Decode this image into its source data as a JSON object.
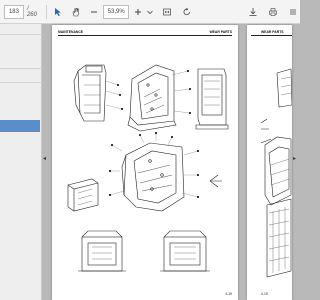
{
  "toolbar": {
    "current_page": "183",
    "total_pages": "/ 260",
    "zoom": "53,9%",
    "icons": [
      "cursor-icon",
      "hand-icon",
      "zoom-out-icon",
      "zoom-in-icon",
      "zoom-dropdown-icon",
      "fit-page-icon",
      "rotate-icon",
      "download-icon",
      "print-icon",
      "more-icon"
    ]
  },
  "sidebar": {
    "selected_color": "#5a8ec9"
  },
  "page_left": {
    "title": "MAINTENANCE",
    "section": "WEAR PARTS",
    "page_number": "4-19"
  },
  "page_right": {
    "section": "WEAR PARTS",
    "page_number": "4-19"
  },
  "controls": {
    "collapse_glyph": "◂",
    "expand_glyph": "▸"
  }
}
